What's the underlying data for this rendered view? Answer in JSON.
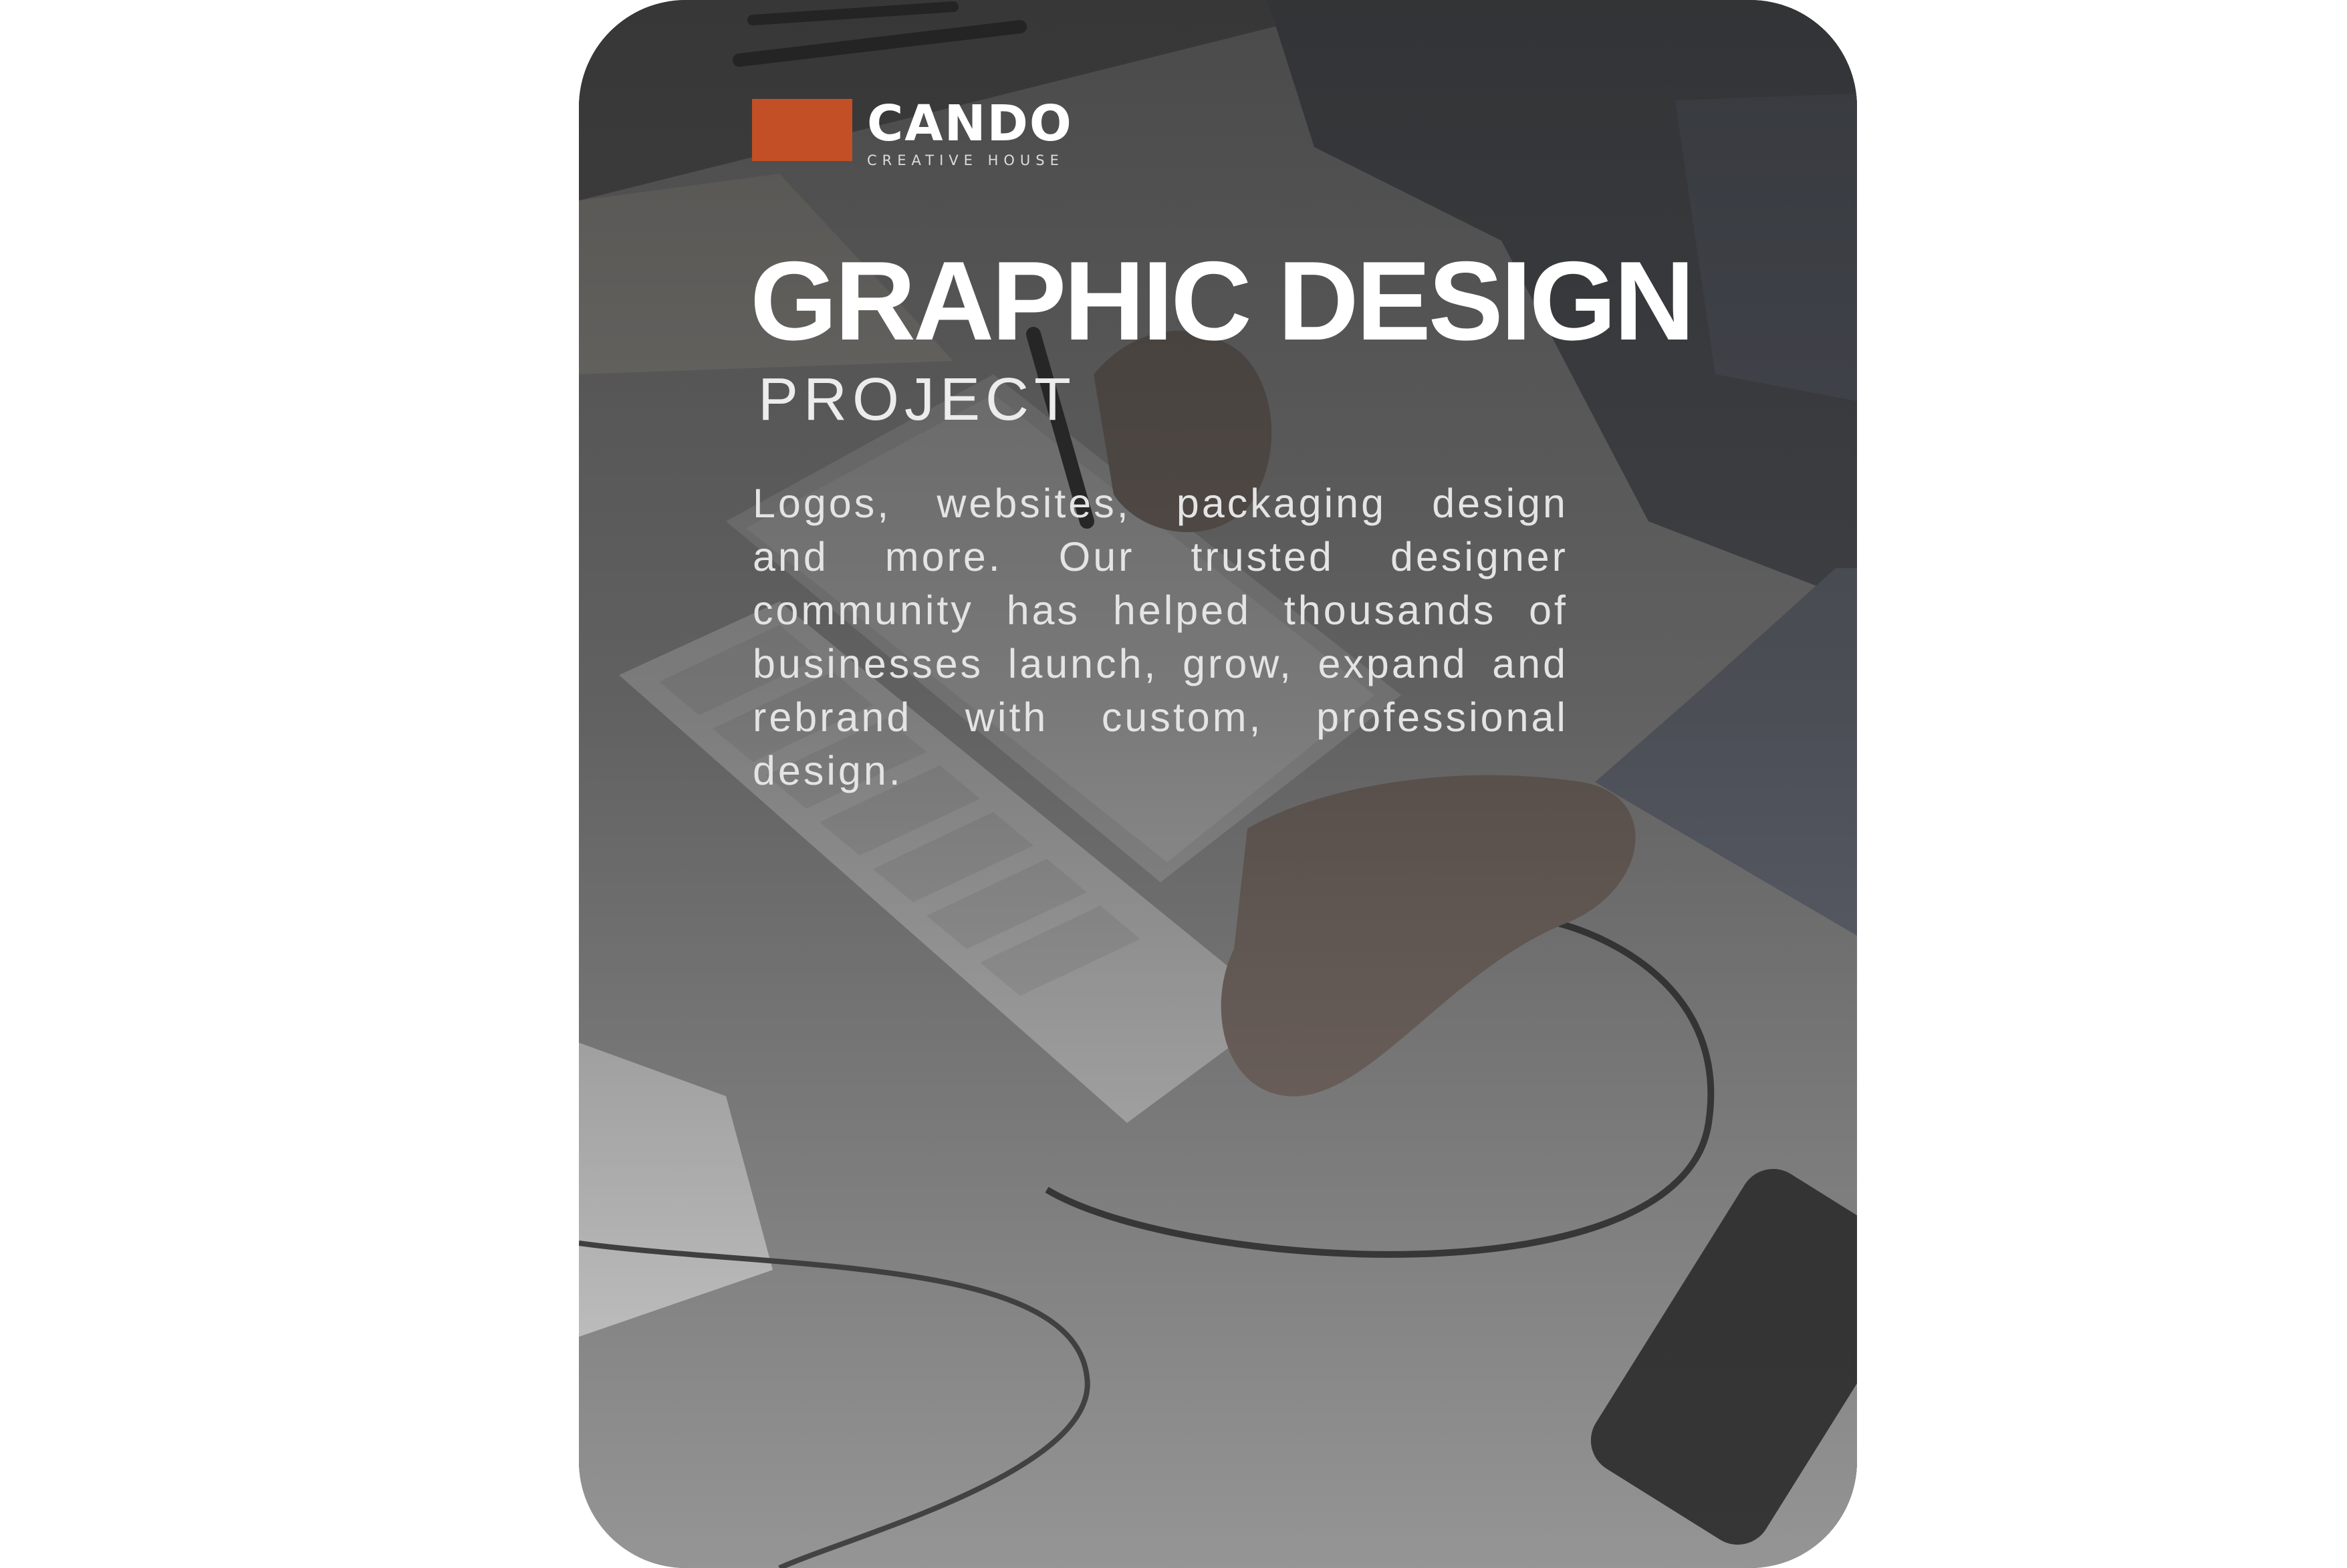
{
  "brand": {
    "name": "CANDO",
    "tagline": "CREATIVE HOUSE",
    "accent_color": "#c24f26"
  },
  "hero": {
    "title": "GRAPHIC DESIGN",
    "subtitle": "PROJECT",
    "description": "Logos, websites, packaging design and more. Our trusted designer community has helped thousands of businesses launch, grow, expand and rebrand with custom, professional design."
  },
  "background": {
    "icon": "desk-workspace-photo"
  }
}
